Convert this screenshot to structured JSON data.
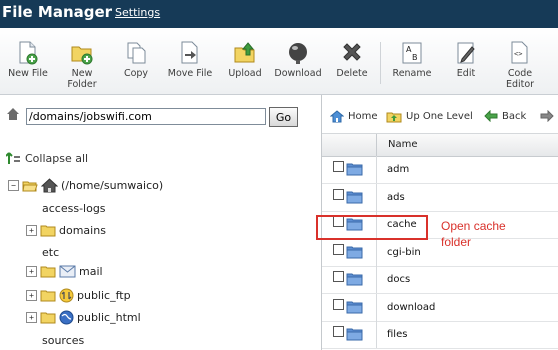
{
  "header": {
    "title": "File Manager",
    "settings_link": "Settings"
  },
  "toolbar": {
    "buttons": [
      {
        "label": "New File",
        "icon": "new-file-icon"
      },
      {
        "label": "New\nFolder",
        "icon": "new-folder-icon"
      },
      {
        "label": "Copy",
        "icon": "copy-icon"
      },
      {
        "label": "Move File",
        "icon": "move-file-icon"
      },
      {
        "label": "Upload",
        "icon": "upload-icon"
      },
      {
        "label": "Download",
        "icon": "download-icon"
      },
      {
        "label": "Delete",
        "icon": "delete-icon"
      },
      {
        "label": "Rename",
        "icon": "rename-icon"
      },
      {
        "label": "Edit",
        "icon": "edit-icon"
      },
      {
        "label": "Code\nEditor",
        "icon": "code-editor-icon"
      }
    ]
  },
  "address": {
    "path": "/domains/jobswifi.com",
    "go_label": "Go"
  },
  "nav": {
    "home": "Home",
    "up": "Up One Level",
    "back": "Back"
  },
  "tree": {
    "collapse_all": "Collapse all",
    "root": "(/home/sumwaico)",
    "items": [
      {
        "label": "access-logs",
        "expandable": false
      },
      {
        "label": "domains",
        "expandable": true
      },
      {
        "label": "etc",
        "expandable": false
      },
      {
        "label": "mail",
        "expandable": true
      },
      {
        "label": "public_ftp",
        "expandable": true
      },
      {
        "label": "public_html",
        "expandable": true
      },
      {
        "label": "sources",
        "expandable": false
      }
    ]
  },
  "files": {
    "column_name": "Name",
    "rows": [
      "adm",
      "ads",
      "cache",
      "cgi-bin",
      "docs",
      "download",
      "files"
    ]
  },
  "annotation": {
    "line1": "Open cache",
    "line2": "folder",
    "color": "#d9312b"
  },
  "colors": {
    "header_bg": "#163a57",
    "accent_red": "#d9312b",
    "folder_blue": "#5d8fd3"
  }
}
